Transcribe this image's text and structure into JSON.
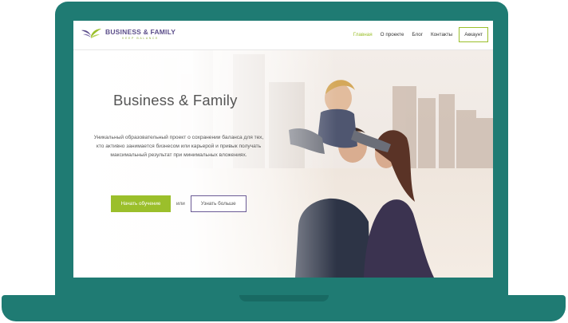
{
  "logo": {
    "title": "BUSINESS & FAMILY",
    "subtitle": "KEEP BALANCE"
  },
  "nav": {
    "items": [
      {
        "label": "Главная",
        "active": true
      },
      {
        "label": "О проекте",
        "active": false
      },
      {
        "label": "Блог",
        "active": false
      },
      {
        "label": "Контакты",
        "active": false
      }
    ],
    "account_label": "Аккаунт"
  },
  "hero": {
    "title": "Business & Family",
    "description": "Уникальный образовательный проект о сохранении баланса для тех, кто активно занимается бизнесом или карьерой и привык получать максимальный результат при минимальных вложениях.",
    "primary_label": "Начать обучение",
    "or_label": "или",
    "secondary_label": "Узнать больше"
  },
  "colors": {
    "device": "#1f7b73",
    "accent_green": "#9bbf2b",
    "accent_purple": "#6b5b95",
    "text": "#555555"
  }
}
